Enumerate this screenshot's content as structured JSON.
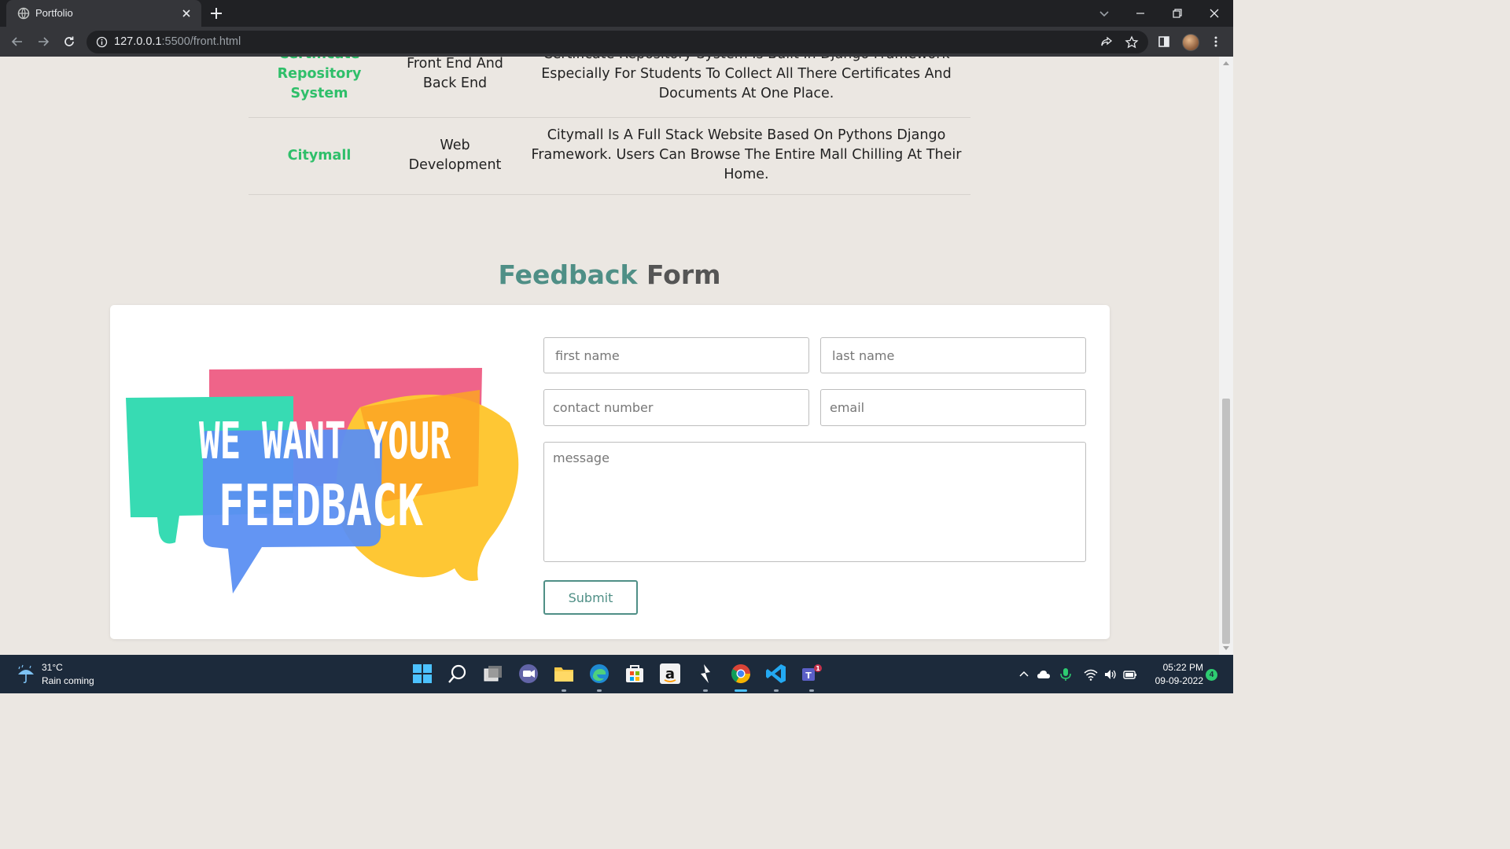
{
  "browser": {
    "tab_title": "Portfolio",
    "url_host": "127.0.0.1",
    "url_path": ":5500/front.html"
  },
  "projects": [
    {
      "name": "Certificate Repository System",
      "type": "Front End And Back End",
      "description": "Certificate Repository System Is Built In Django Framework Especially For Students To Collect All There Certificates And Documents At One Place."
    },
    {
      "name": "Citymall",
      "type": "Web Development",
      "description": "Citymall Is A Full Stack Website Based On Pythons Django Framework. Users Can Browse The Entire Mall Chilling At Their Home."
    }
  ],
  "feedback": {
    "heading_accent": "Feedback",
    "heading_rest": "Form",
    "image_text_line1": "WE WANT YOUR",
    "image_text_line2": "FEEDBACK",
    "first_name_placeholder": "first name",
    "last_name_placeholder": "last name",
    "contact_placeholder": "contact number",
    "email_placeholder": "email",
    "message_placeholder": "message",
    "submit_label": "Submit"
  },
  "taskbar": {
    "weather_temp": "31°C",
    "weather_desc": "Rain coming",
    "time": "05:22 PM",
    "date": "09-09-2022",
    "notification_count": "4",
    "teams_badge": "1"
  },
  "colors": {
    "accent": "#4f8f86",
    "project_name": "#2fbf6a",
    "page_bg": "#ebe7e2"
  }
}
